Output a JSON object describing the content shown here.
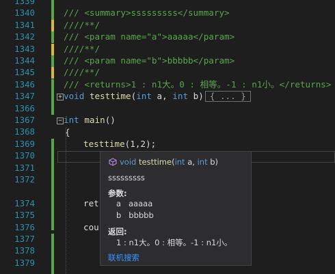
{
  "editor": {
    "line_numbers": [
      "1339",
      "1340",
      "1341",
      "1342",
      "1343",
      "1344",
      "1345",
      "1346",
      "1347",
      "1366",
      "1367",
      "1368",
      "1369",
      "1370",
      "1371",
      "1372",
      "1374",
      "1375",
      "1376",
      "1377",
      "1378",
      "1379"
    ],
    "lines": {
      "l1340": "/// <summary>sssssssss</summary>",
      "l1341": "////**/",
      "l1342": "/// <param name=\"a\">aaaaa</param>",
      "l1343": "////**/",
      "l1344": "/// <param name=\"b\">bbbbb</param>",
      "l1345": "////**/",
      "l1346": "/// <returns>1 : n1大。0 : 相等。-1 : n1小。</returns>",
      "l1347_kw": "void",
      "l1347_fn": "testtime",
      "l1347_rest": "(",
      "l1347_int1": "int",
      "l1347_a": " a, ",
      "l1347_int2": "int",
      "l1347_b": " b)",
      "l1347_collapsed": "{ ... }",
      "l1367_kw": "int",
      "l1367_fn": "main",
      "l1367_rest": "()",
      "l1368": "{",
      "l1369_fn": "testtime",
      "l1369_rest": "(1,2);",
      "l1374": "ret",
      "l1376": "cou"
    }
  },
  "tooltip": {
    "sig_kw": "void",
    "sig_fn": "testtime",
    "sig_open": "(",
    "sig_int1": "int",
    "sig_a": " a, ",
    "sig_int2": "int",
    "sig_b": " b)",
    "summary": "sssssssss",
    "params_header": "参数:",
    "param_a": "a   aaaaa",
    "param_b": "b   bbbbb",
    "returns_header": "返回:",
    "returns_text": "1 : n1大。0 : 相等。-1 : n1小。",
    "link": "联机搜索"
  },
  "colors": {
    "background": "#1e1e1e",
    "line_number": "#2b91af",
    "comment": "#57a64a",
    "keyword": "#569cd6",
    "function": "#dcdcaa",
    "changed_saved": "#57a64a",
    "changed_unsaved": "#d7ba3d",
    "tooltip_bg": "#2d2d30",
    "link": "#3794ff"
  }
}
